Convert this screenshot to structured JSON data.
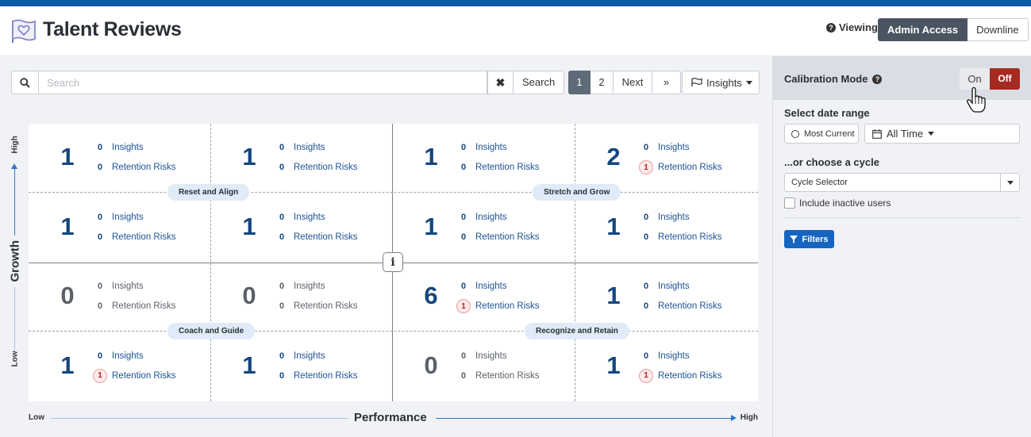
{
  "header": {
    "title": "Talent Reviews",
    "viewing_label": "Viewing",
    "view_options": [
      "Admin Access",
      "Downline"
    ]
  },
  "toolbar": {
    "search_placeholder": "Search",
    "search_button": "Search",
    "clear_icon": "x-icon",
    "pages": [
      "1",
      "2"
    ],
    "next_label": "Next",
    "last_label": "»",
    "insights_label": "Insights"
  },
  "grid": {
    "quadrant_labels": [
      "Reset and Align",
      "Stretch and Grow",
      "Coach and Guide",
      "Recognize and Retain"
    ],
    "insights_label": "Insights",
    "risks_label": "Retention Risks",
    "rows": [
      [
        {
          "count": "1",
          "insights": "0",
          "risks": "0"
        },
        {
          "count": "1",
          "insights": "0",
          "risks": "0"
        },
        {
          "count": "1",
          "insights": "0",
          "risks": "0"
        },
        {
          "count": "2",
          "insights": "0",
          "risks": "1"
        }
      ],
      [
        {
          "count": "1",
          "insights": "0",
          "risks": "0"
        },
        {
          "count": "1",
          "insights": "0",
          "risks": "0"
        },
        {
          "count": "1",
          "insights": "0",
          "risks": "0"
        },
        {
          "count": "1",
          "insights": "0",
          "risks": "0"
        }
      ],
      [
        {
          "count": "0",
          "insights": "0",
          "risks": "0"
        },
        {
          "count": "0",
          "insights": "0",
          "risks": "0"
        },
        {
          "count": "6",
          "insights": "0",
          "risks": "1"
        },
        {
          "count": "1",
          "insights": "0",
          "risks": "0"
        }
      ],
      [
        {
          "count": "1",
          "insights": "0",
          "risks": "1"
        },
        {
          "count": "1",
          "insights": "0",
          "risks": "0"
        },
        {
          "count": "0",
          "insights": "0",
          "risks": "0"
        },
        {
          "count": "1",
          "insights": "0",
          "risks": "1"
        }
      ]
    ]
  },
  "axes": {
    "y_title": "Growth",
    "y_high": "High",
    "y_low": "Low",
    "x_title": "Performance",
    "x_low": "Low",
    "x_high": "High"
  },
  "sidepanel": {
    "calibration_label": "Calibration Mode",
    "toggle_on": "On",
    "toggle_off": "Off",
    "date_range_label": "Select date range",
    "most_current": "Most Current",
    "all_time": "All Time",
    "cycle_label": "...or choose a cycle",
    "cycle_selector": "Cycle Selector",
    "include_inactive": "Include inactive users",
    "filters_button": "Filters"
  },
  "colors": {
    "brand_blue": "#0b5aa6",
    "count_blue": "#15467f",
    "risk_red": "#b3201f",
    "off_red": "#a52a22",
    "filters_blue": "#1565c0"
  }
}
